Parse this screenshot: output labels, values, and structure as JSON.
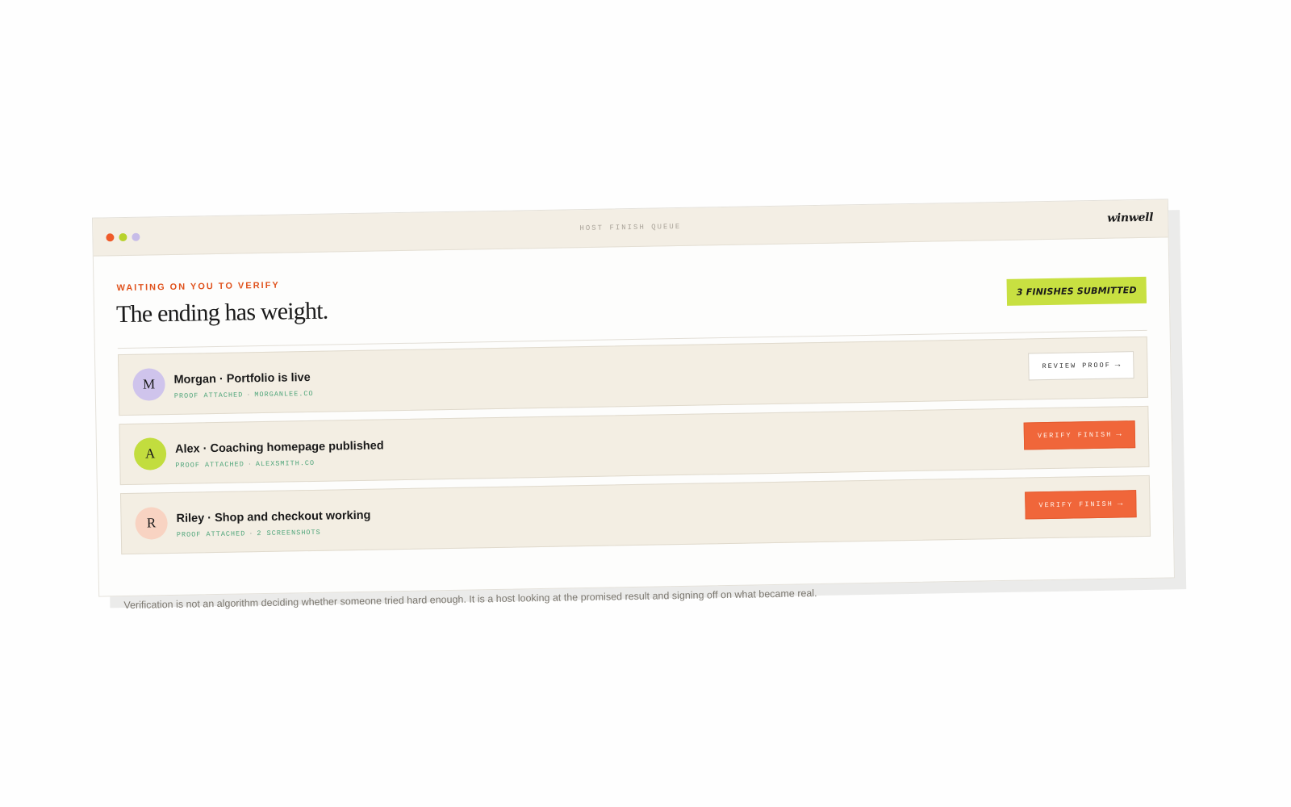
{
  "window": {
    "title": "HOST FINISH QUEUE",
    "brand": "winwell",
    "dots": [
      {
        "color": "#ef5b2a"
      },
      {
        "color": "#b8d22c"
      },
      {
        "color": "#c7bce8"
      }
    ]
  },
  "header": {
    "eyebrow": "WAITING ON YOU TO VERIFY",
    "title": "The ending has weight.",
    "badge": "3 FINISHES SUBMITTED"
  },
  "rows": [
    {
      "initial": "M",
      "avatar_color": "#cfc4ec",
      "title": "Morgan · Portfolio is live",
      "meta_left": "PROOF ATTACHED",
      "meta_sep": "·",
      "meta_right": "MORGANLEE.CO",
      "action_label": "REVIEW PROOF",
      "action_arrow": "→",
      "action_style": "secondary"
    },
    {
      "initial": "A",
      "avatar_color": "#c2dd3e",
      "title": "Alex · Coaching homepage published",
      "meta_left": "PROOF ATTACHED",
      "meta_sep": "·",
      "meta_right": "ALEXSMITH.CO",
      "action_label": "VERIFY FINISH",
      "action_arrow": "→",
      "action_style": "primary"
    },
    {
      "initial": "R",
      "avatar_color": "#f8d3c2",
      "title": "Riley · Shop and checkout working",
      "meta_left": "PROOF ATTACHED",
      "meta_sep": "·",
      "meta_right": "2 SCREENSHOTS",
      "action_label": "VERIFY FINISH",
      "action_arrow": "→",
      "action_style": "primary"
    }
  ],
  "footnote": "Verification is not an algorithm deciding whether someone tried hard enough. It is a host looking at the promised result and signing off on what became real.",
  "colors": {
    "accent": "#f0663a",
    "badge": "#c8e041",
    "row_bg": "#f3eee3",
    "meta": "#4fa57a"
  }
}
